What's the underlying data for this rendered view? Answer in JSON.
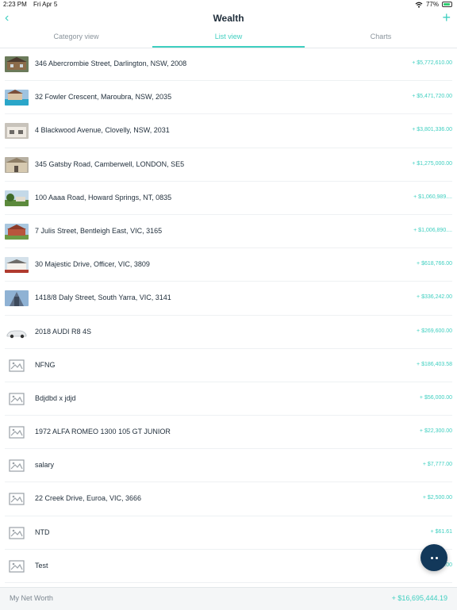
{
  "status": {
    "time": "2:23 PM",
    "date": "Fri Apr 5",
    "battery": "77%",
    "battery_level": 0.77
  },
  "nav": {
    "back_icon": "‹",
    "title": "Wealth",
    "add_icon": "+"
  },
  "tabs": [
    {
      "label": "Category view",
      "active": false
    },
    {
      "label": "List view",
      "active": true
    },
    {
      "label": "Charts",
      "active": false
    }
  ],
  "items": [
    {
      "name": "346 Abercrombie Street, Darlington, NSW, 2008",
      "value": "+ $5,772,610.00",
      "thumb": "house1"
    },
    {
      "name": "32 Fowler Crescent, Maroubra, NSW, 2035",
      "value": "+ $5,471,720.00",
      "thumb": "house2"
    },
    {
      "name": "4 Blackwood Avenue, Clovelly, NSW, 2031",
      "value": "+ $3,801,336.00",
      "thumb": "house3"
    },
    {
      "name": "345 Gatsby Road, Camberwell, LONDON, SE5",
      "value": "+ $1,275,000.00",
      "thumb": "house4"
    },
    {
      "name": "100 Aaaa Road, Howard Springs, NT, 0835",
      "value": "+ $1,060,989....",
      "thumb": "house5"
    },
    {
      "name": "7 Julis Street, Bentleigh East, VIC, 3165",
      "value": "+ $1,006,890....",
      "thumb": "house6"
    },
    {
      "name": "30 Majestic Drive, Officer, VIC, 3809",
      "value": "+ $618,766.00",
      "thumb": "house7"
    },
    {
      "name": "1418/8 Daly Street, South Yarra, VIC, 3141",
      "value": "+ $336,242.00",
      "thumb": "house8"
    },
    {
      "name": "2018 AUDI R8 4S",
      "value": "+ $269,600.00",
      "thumb": "car"
    },
    {
      "name": "NFNG",
      "value": "+ $186,403.58",
      "thumb": "placeholder"
    },
    {
      "name": "Bdjdbd x jdjd",
      "value": "+ $56,000.00",
      "thumb": "placeholder"
    },
    {
      "name": "1972 ALFA ROMEO 1300 105 GT JUNIOR",
      "value": "+ $22,300.00",
      "thumb": "placeholder"
    },
    {
      "name": "salary",
      "value": "+ $7,777.00",
      "thumb": "placeholder"
    },
    {
      "name": "22 Creek Drive, Euroa, VIC, 3666",
      "value": "+ $2,500.00",
      "thumb": "placeholder"
    },
    {
      "name": "NTD",
      "value": "+ $61.61",
      "thumb": "placeholder"
    },
    {
      "name": "Test",
      "value": "+ $0.00",
      "thumb": "placeholder"
    }
  ],
  "footer": {
    "label": "My Net Worth",
    "value": "+ $16,695,444.19"
  },
  "colors": {
    "accent": "#3fcfc0",
    "fab": "#12385a"
  }
}
